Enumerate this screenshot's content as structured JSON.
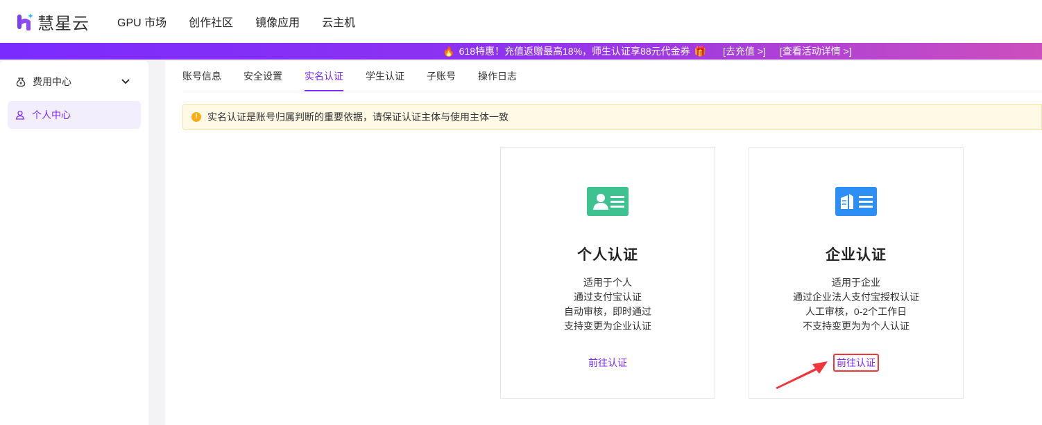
{
  "header": {
    "logo_text": "慧星云",
    "nav": [
      "GPU 市场",
      "创作社区",
      "镜像应用",
      "云主机"
    ]
  },
  "banner": {
    "text": "618特惠！充值返赠最高18%，师生认证享88元代金券",
    "recharge": "[去充值 >]",
    "details": "[查看活动详情 >]"
  },
  "sidebar": {
    "items": [
      {
        "label": "费用中心"
      },
      {
        "label": "个人中心"
      }
    ]
  },
  "tabs": [
    "账号信息",
    "安全设置",
    "实名认证",
    "学生认证",
    "子账号",
    "操作日志"
  ],
  "alert": "实名认证是账号归属判断的重要依据，请保证认证主体与使用主体一致",
  "cards": [
    {
      "title": "个人认证",
      "lines": [
        "适用于个人",
        "通过支付宝认证",
        "自动审核，即时通过",
        "支持变更为企业认证"
      ],
      "action": "前往认证",
      "color": "#3ec28f"
    },
    {
      "title": "企业认证",
      "lines": [
        "适用于企业",
        "通过企业法人支付宝授权认证",
        "人工审核，0-2个工作日",
        "不支持变更为为个人认证"
      ],
      "action": "前往认证",
      "color": "#2d8ff5"
    }
  ]
}
